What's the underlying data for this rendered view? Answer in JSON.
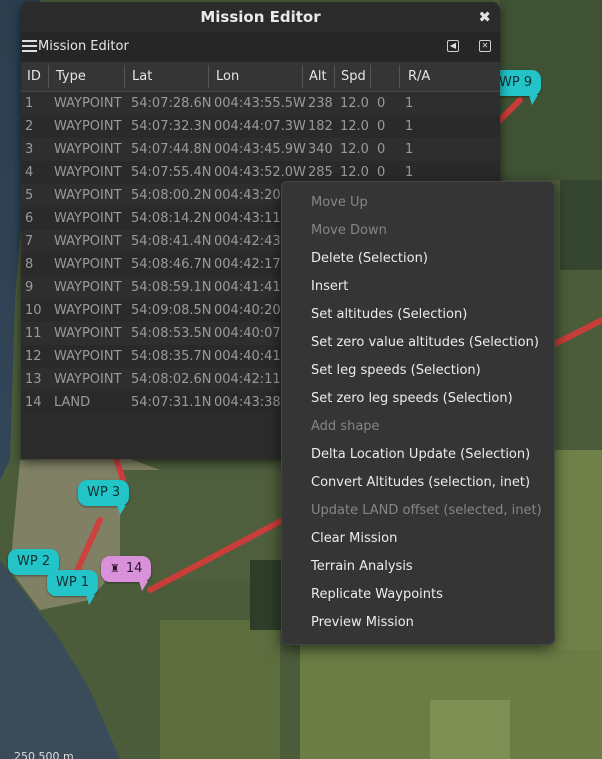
{
  "map": {
    "waypoint_labels": [
      {
        "id": "wp9",
        "text": "WP 9",
        "kind": "waypoint"
      },
      {
        "id": "wp3",
        "text": "WP 3",
        "kind": "waypoint"
      },
      {
        "id": "wp2",
        "text": "WP 2",
        "kind": "waypoint"
      },
      {
        "id": "wp1",
        "text": "WP 1",
        "kind": "waypoint"
      },
      {
        "id": "wp14",
        "text": "14",
        "kind": "land"
      }
    ],
    "scale_text": "250    500 m",
    "route_color": "#d63a3a",
    "waypoint_color": "#22c4c8",
    "land_color": "#d991d9"
  },
  "window": {
    "title": "Mission Editor",
    "close_icon": "close-icon"
  },
  "panel": {
    "menu_icon": "hamburger-menu-icon",
    "title": "Mission Editor",
    "detach_icon": "detach-icon",
    "close_icon": "close-icon"
  },
  "table": {
    "columns": [
      "ID",
      "Type",
      "Lat",
      "Lon",
      "Alt",
      "Spd",
      "",
      "R/A"
    ],
    "rows": [
      {
        "id": "1",
        "type": "WAYPOINT",
        "lat": "54:07:28.6N",
        "lon": "004:43:55.5W",
        "alt": "238",
        "spd": "12.0",
        "c7": "0",
        "ra": "1"
      },
      {
        "id": "2",
        "type": "WAYPOINT",
        "lat": "54:07:32.3N",
        "lon": "004:44:07.3W",
        "alt": "182",
        "spd": "12.0",
        "c7": "0",
        "ra": "1"
      },
      {
        "id": "3",
        "type": "WAYPOINT",
        "lat": "54:07:44.8N",
        "lon": "004:43:45.9W",
        "alt": "340",
        "spd": "12.0",
        "c7": "0",
        "ra": "1"
      },
      {
        "id": "4",
        "type": "WAYPOINT",
        "lat": "54:07:55.4N",
        "lon": "004:43:52.0W",
        "alt": "285",
        "spd": "12.0",
        "c7": "0",
        "ra": "1"
      },
      {
        "id": "5",
        "type": "WAYPOINT",
        "lat": "54:08:00.2N",
        "lon": "004:43:20.",
        "alt": "",
        "spd": "",
        "c7": "",
        "ra": ""
      },
      {
        "id": "6",
        "type": "WAYPOINT",
        "lat": "54:08:14.2N",
        "lon": "004:43:11.",
        "alt": "",
        "spd": "",
        "c7": "",
        "ra": ""
      },
      {
        "id": "7",
        "type": "WAYPOINT",
        "lat": "54:08:41.4N",
        "lon": "004:42:43.",
        "alt": "",
        "spd": "",
        "c7": "",
        "ra": ""
      },
      {
        "id": "8",
        "type": "WAYPOINT",
        "lat": "54:08:46.7N",
        "lon": "004:42:17.",
        "alt": "",
        "spd": "",
        "c7": "",
        "ra": ""
      },
      {
        "id": "9",
        "type": "WAYPOINT",
        "lat": "54:08:59.1N",
        "lon": "004:41:41.8",
        "alt": "",
        "spd": "",
        "c7": "",
        "ra": ""
      },
      {
        "id": "10",
        "type": "WAYPOINT",
        "lat": "54:09:08.5N",
        "lon": "004:40:20.",
        "alt": "",
        "spd": "",
        "c7": "",
        "ra": ""
      },
      {
        "id": "11",
        "type": "WAYPOINT",
        "lat": "54:08:53.5N",
        "lon": "004:40:07.",
        "alt": "",
        "spd": "",
        "c7": "",
        "ra": ""
      },
      {
        "id": "12",
        "type": "WAYPOINT",
        "lat": "54:08:35.7N",
        "lon": "004:40:41.",
        "alt": "",
        "spd": "",
        "c7": "",
        "ra": ""
      },
      {
        "id": "13",
        "type": "WAYPOINT",
        "lat": "54:08:02.6N",
        "lon": "004:42:11.",
        "alt": "",
        "spd": "",
        "c7": "",
        "ra": ""
      },
      {
        "id": "14",
        "type": "LAND",
        "lat": "54:07:31.1N",
        "lon": "004:43:38.",
        "alt": "",
        "spd": "",
        "c7": "",
        "ra": ""
      }
    ]
  },
  "context_menu": {
    "items": [
      {
        "label": "Move Up",
        "enabled": false
      },
      {
        "label": "Move Down",
        "enabled": false
      },
      {
        "label": "Delete (Selection)",
        "enabled": true
      },
      {
        "label": "Insert",
        "enabled": true
      },
      {
        "label": "Set altitudes (Selection)",
        "enabled": true
      },
      {
        "label": "Set zero value altitudes (Selection)",
        "enabled": true
      },
      {
        "label": "Set leg speeds (Selection)",
        "enabled": true
      },
      {
        "label": "Set zero leg speeds (Selection)",
        "enabled": true
      },
      {
        "label": "Add shape",
        "enabled": false
      },
      {
        "label": "Delta Location Update (Selection)",
        "enabled": true
      },
      {
        "label": "Convert Altitudes (selection, inet)",
        "enabled": true
      },
      {
        "label": "Update LAND offset (selected, inet)",
        "enabled": false
      },
      {
        "label": "Clear Mission",
        "enabled": true
      },
      {
        "label": "Terrain Analysis",
        "enabled": true
      },
      {
        "label": "Replicate Waypoints",
        "enabled": true
      },
      {
        "label": "Preview Mission",
        "enabled": true
      }
    ]
  }
}
